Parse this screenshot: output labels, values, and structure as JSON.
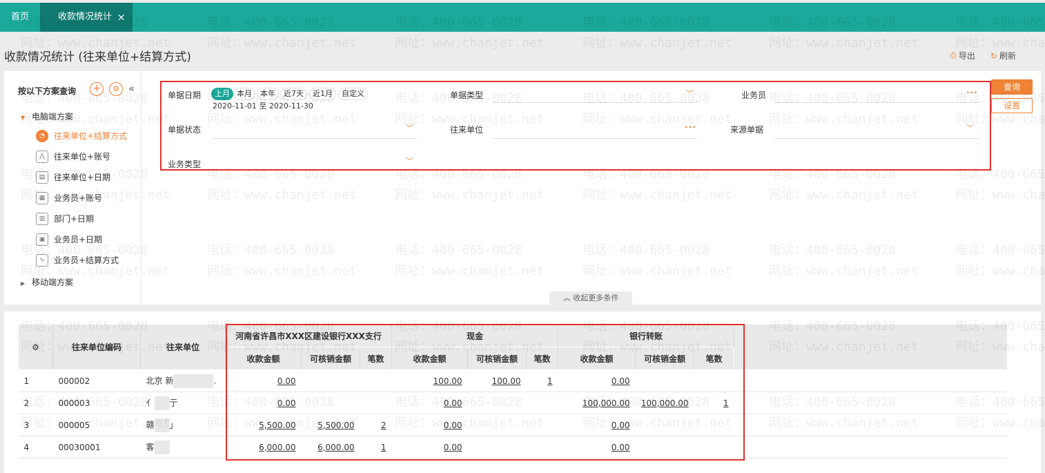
{
  "tabs": {
    "home": "首页",
    "active": "收款情况统计",
    "close": "×"
  },
  "title": "收款情况统计 (往来单位+结算方式)",
  "actions": {
    "export": "导出",
    "refresh": "刷新"
  },
  "sidebar": {
    "heading": "按以下方案查询",
    "collapse": "«",
    "groups": {
      "pc": "电脑端方案",
      "mobile": "移动端方案"
    },
    "items": [
      "往来单位+结算方式",
      "往来单位+账号",
      "往来单位+日期",
      "业务员+账号",
      "部门+日期",
      "业务员+日期",
      "业务员+结算方式"
    ]
  },
  "filters": {
    "date_label": "单据日期",
    "date_chips": [
      "上月",
      "本月",
      "本年",
      "近7天",
      "近1月",
      "自定义"
    ],
    "date_range": "2020-11-01 至 2020-11-30",
    "doc_type": "单据类型",
    "salesperson": "业务员",
    "doc_status": "单据状态",
    "partner": "往来单位",
    "source_doc": "来源单据",
    "biz_type": "业务类型"
  },
  "buttons": {
    "query": "查询",
    "settings": "设置",
    "more": "收起更多条件"
  },
  "table": {
    "headers": {
      "code": "往来单位编码",
      "name": "往来单位"
    },
    "groups": [
      "河南省许昌市XXX区建设银行XXX支行",
      "现金",
      "银行转账"
    ],
    "sub": [
      "收款金额",
      "可核销金额",
      "笔数"
    ],
    "rows": [
      {
        "idx": "1",
        "code": "000002",
        "name": "北京 新",
        "suffix": ".",
        "v": [
          "0.00",
          "",
          "",
          "100.00",
          "100.00",
          "1",
          "0.00",
          "",
          ""
        ]
      },
      {
        "idx": "2",
        "code": "000003",
        "name": "亻",
        "suffix": "亍",
        "v": [
          "0.00",
          "",
          "",
          "0.00",
          "",
          "",
          "100,000.00",
          "100,000.00",
          "1"
        ]
      },
      {
        "idx": "3",
        "code": "000005",
        "name": "赣",
        "suffix": "」",
        "v": [
          "5,500.00",
          "5,500.00",
          "2",
          "0.00",
          "",
          "",
          "0.00",
          "",
          ""
        ]
      },
      {
        "idx": "4",
        "code": "00030001",
        "name": "客",
        "suffix": "",
        "v": [
          "6,000.00",
          "6,000.00",
          "1",
          "0.00",
          "",
          "",
          "0.00",
          "",
          ""
        ]
      }
    ]
  },
  "watermark": {
    "phone": "电话：400-665-0028",
    "site": "网址：www.chanjet.net"
  },
  "colors": {
    "teal": "#1aa99a",
    "teal_dark": "#107a70",
    "orange": "#f08236",
    "red": "#e0312d"
  }
}
